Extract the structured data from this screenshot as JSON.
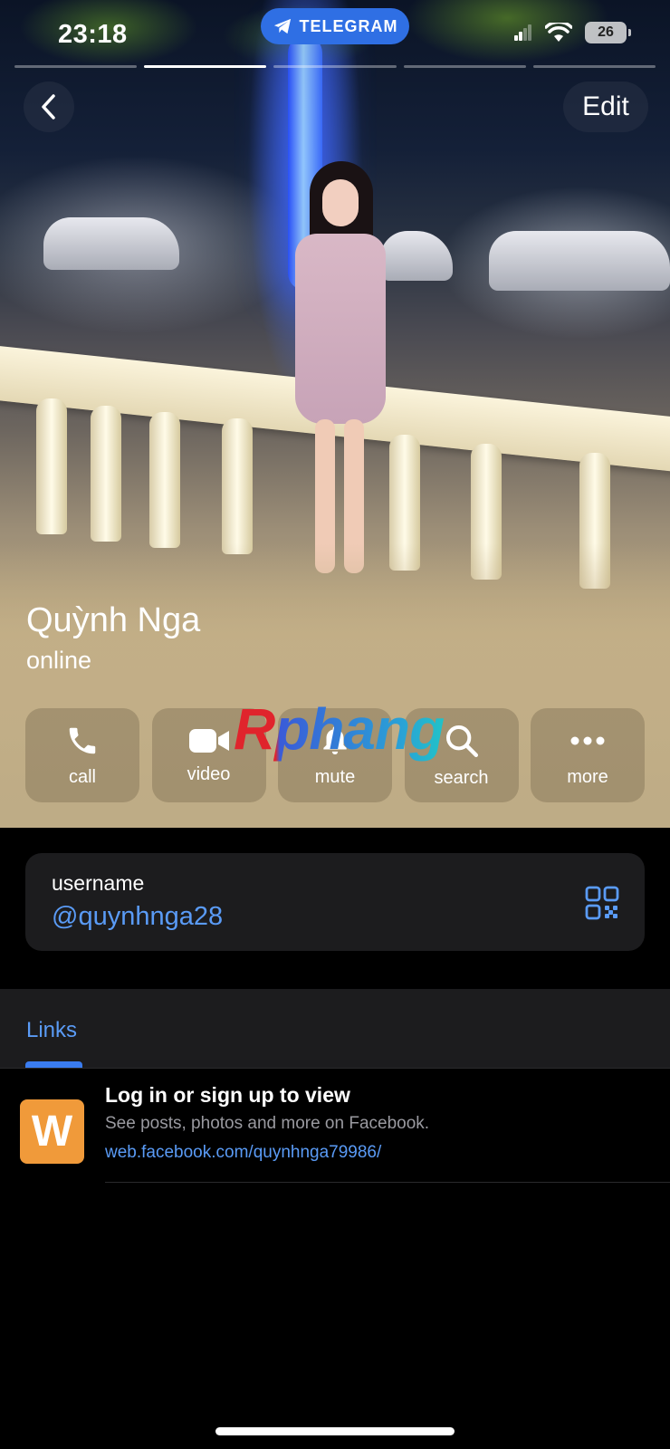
{
  "status_bar": {
    "time": "23:18",
    "app_pill": "TELEGRAM",
    "battery": "26"
  },
  "stories": {
    "count": 5,
    "active_index": 1
  },
  "header": {
    "back_icon": "chevron-left-icon",
    "edit_label": "Edit"
  },
  "profile": {
    "name": "Quỳnh Nga",
    "presence": "online"
  },
  "actions": [
    {
      "label": "call",
      "icon": "phone-icon"
    },
    {
      "label": "video",
      "icon": "video-camera-icon"
    },
    {
      "label": "mute",
      "icon": "bell-icon"
    },
    {
      "label": "search",
      "icon": "search-icon"
    },
    {
      "label": "more",
      "icon": "more-dots-icon"
    }
  ],
  "watermark": "Rphang",
  "username_card": {
    "caption": "username",
    "handle": "@quynhnga28",
    "qr_icon": "qr-code-icon"
  },
  "links": {
    "tab_label": "Links",
    "items": [
      {
        "thumb_letter": "W",
        "title": "Log in or sign up to view",
        "description": "See posts, photos and more on Facebook.",
        "url": "web.facebook.com/quynhnga79986/"
      }
    ]
  },
  "colors": {
    "accent": "#5a9bf6",
    "telegram_pill": "#2f6fe4",
    "card_bg": "#1c1c1e",
    "link_thumb": "#f09a3a"
  }
}
